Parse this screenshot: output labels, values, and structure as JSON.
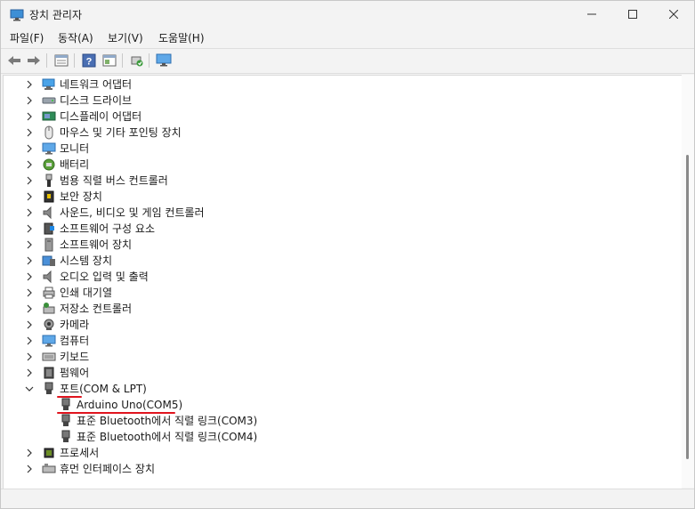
{
  "window": {
    "title": "장치 관리자"
  },
  "menu": [
    "파일(F)",
    "동작(A)",
    "보기(V)",
    "도움말(H)"
  ],
  "toolbar_icons": [
    "back-arrow-icon",
    "forward-arrow-icon",
    "properties-grid-icon",
    "help-icon",
    "driver-details-icon",
    "scan-hardware-icon",
    "monitor-icon"
  ],
  "tree": {
    "before_ports": [
      {
        "label": "네트워크 어댑터",
        "icon": "network-adapter-icon"
      },
      {
        "label": "디스크 드라이브",
        "icon": "disk-drive-icon"
      },
      {
        "label": "디스플레이 어댑터",
        "icon": "display-adapter-icon"
      },
      {
        "label": "마우스 및 기타 포인팅 장치",
        "icon": "mouse-icon"
      },
      {
        "label": "모니터",
        "icon": "monitor-icon"
      },
      {
        "label": "배터리",
        "icon": "battery-icon"
      },
      {
        "label": "범용 직렬 버스 컨트롤러",
        "icon": "usb-icon"
      },
      {
        "label": "보안 장치",
        "icon": "security-device-icon"
      },
      {
        "label": "사운드, 비디오 및 게임 컨트롤러",
        "icon": "speaker-icon"
      },
      {
        "label": "소프트웨어 구성 요소",
        "icon": "software-component-icon"
      },
      {
        "label": "소프트웨어 장치",
        "icon": "software-device-icon"
      },
      {
        "label": "시스템 장치",
        "icon": "system-device-icon"
      },
      {
        "label": "오디오 입력 및 출력",
        "icon": "audio-io-icon"
      },
      {
        "label": "인쇄 대기열",
        "icon": "printer-icon"
      },
      {
        "label": "저장소 컨트롤러",
        "icon": "storage-controller-icon"
      },
      {
        "label": "카메라",
        "icon": "camera-icon"
      },
      {
        "label": "컴퓨터",
        "icon": "computer-icon"
      },
      {
        "label": "키보드",
        "icon": "keyboard-icon"
      },
      {
        "label": "펌웨어",
        "icon": "firmware-icon"
      }
    ],
    "ports": {
      "label": "포트(COM & LPT)",
      "icon": "port-icon",
      "children": [
        {
          "label": "Arduino Uno(COM5)",
          "icon": "port-icon"
        },
        {
          "label": "표준 Bluetooth에서 직렬 링크(COM3)",
          "icon": "port-icon"
        },
        {
          "label": "표준 Bluetooth에서 직렬 링크(COM4)",
          "icon": "port-icon"
        }
      ]
    },
    "after_ports": [
      {
        "label": "프로세서",
        "icon": "processor-icon"
      },
      {
        "label": "휴먼 인터페이스 장치",
        "icon": "hid-icon"
      }
    ]
  },
  "colors": {
    "highlight": "#e0141e",
    "selection_text": "#1a1a1a"
  }
}
